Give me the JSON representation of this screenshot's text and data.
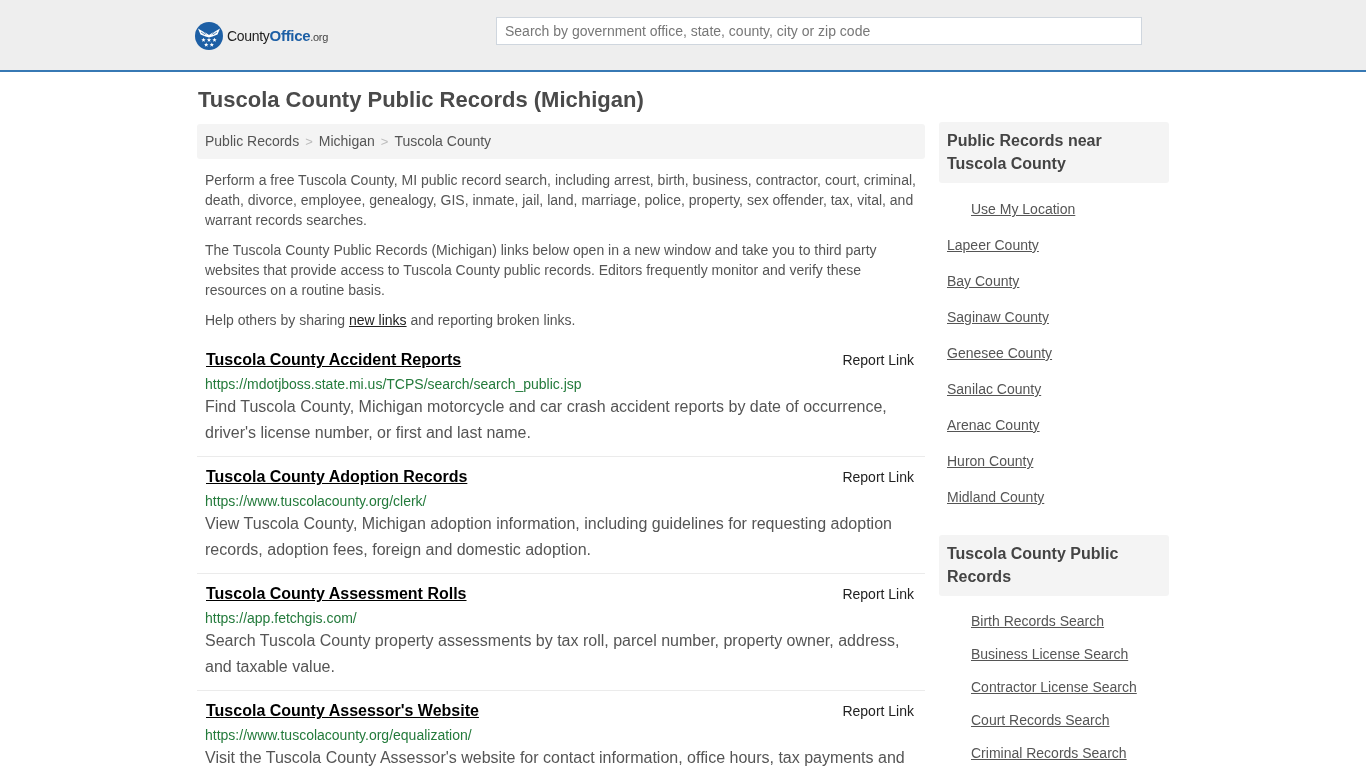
{
  "header": {
    "logo": {
      "name": "County",
      "highlight": "Office",
      "suffix": ".org"
    },
    "search": {
      "placeholder": "Search by government office, state, county, city or zip code"
    }
  },
  "page_title": "Tuscola County Public Records (Michigan)",
  "breadcrumb": [
    {
      "kind": "link",
      "text": "Public Records"
    },
    {
      "kind": "separator",
      "text": ">"
    },
    {
      "kind": "link",
      "text": "Michigan"
    },
    {
      "kind": "separator",
      "text": ">"
    },
    {
      "kind": "link",
      "text": "Tuscola County"
    }
  ],
  "intro": [
    {
      "kind": "text",
      "text": "Perform a free Tuscola County, MI public record search, including arrest, birth, business, contractor, court, criminal, death, divorce, employee, genealogy, GIS, inmate, jail, land, marriage, police, property, sex offender, tax, vital, and warrant records searches."
    },
    {
      "kind": "text",
      "text": "The Tuscola County Public Records (Michigan) links below open in a new window and take you to third party websites that provide access to Tuscola County public records. Editors frequently monitor and verify these resources on a routine basis."
    },
    {
      "kind": "link_text",
      "before": "Help others by sharing ",
      "link": "new links",
      "after": " and reporting broken links."
    }
  ],
  "records": [
    {
      "title": "Tuscola County Accident Reports",
      "report": "Report Link",
      "url": "https://mdotjboss.state.mi.us/TCPS/search/search_public.jsp",
      "description": "Find Tuscola County, Michigan motorcycle and car crash accident reports by date of occurrence, driver's license number, or first and last name."
    },
    {
      "title": "Tuscola County Adoption Records",
      "report": "Report Link",
      "url": "https://www.tuscolacounty.org/clerk/",
      "description": "View Tuscola County, Michigan adoption information, including guidelines for requesting adoption records, adoption fees, foreign and domestic adoption."
    },
    {
      "title": "Tuscola County Assessment Rolls",
      "report": "Report Link",
      "url": "https://app.fetchgis.com/",
      "description": "Search Tuscola County property assessments by tax roll, parcel number, property owner, address, and taxable value."
    },
    {
      "title": "Tuscola County Assessor's Website",
      "report": "Report Link",
      "url": "https://www.tuscolacounty.org/equalization/",
      "description": "Visit the Tuscola County Assessor's website for contact information, office hours, tax payments and"
    }
  ],
  "sidebar": [
    {
      "title": "Public Records near Tuscola County",
      "items": [
        {
          "kind": "location",
          "label": "Use My Location"
        },
        {
          "kind": "county",
          "label": "Lapeer County"
        },
        {
          "kind": "county",
          "label": "Bay County"
        },
        {
          "kind": "county",
          "label": "Saginaw County"
        },
        {
          "kind": "county",
          "label": "Genesee County"
        },
        {
          "kind": "county",
          "label": "Sanilac County"
        },
        {
          "kind": "county",
          "label": "Arenac County"
        },
        {
          "kind": "county",
          "label": "Huron County"
        },
        {
          "kind": "county",
          "label": "Midland County"
        }
      ]
    },
    {
      "title": "Tuscola County Public Records",
      "items": [
        {
          "kind": "search",
          "label": "Birth Records Search"
        },
        {
          "kind": "search",
          "label": "Business License Search"
        },
        {
          "kind": "search",
          "label": "Contractor License Search"
        },
        {
          "kind": "search",
          "label": "Court Records Search"
        },
        {
          "kind": "search",
          "label": "Criminal Records Search"
        }
      ]
    }
  ]
}
